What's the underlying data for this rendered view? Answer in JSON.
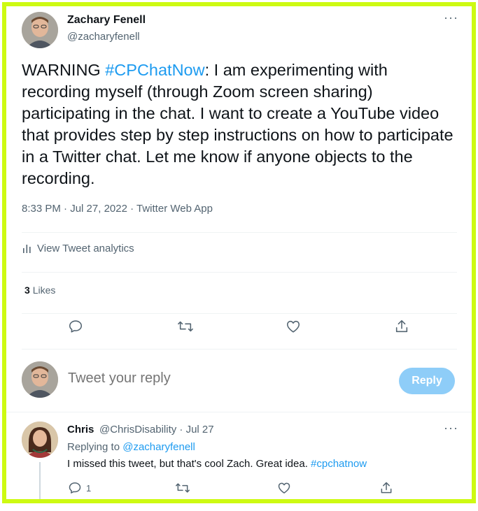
{
  "author": {
    "name": "Zachary Fenell",
    "handle": "@zacharyfenell"
  },
  "tweet": {
    "text_before": "WARNING ",
    "hashtag": "#CPChatNow",
    "text_after": ": I am experimenting with recording myself (through Zoom screen sharing) participating in the chat. I want to create a YouTube video that provides step by step instructions on how to participate in a Twitter chat. Let me know if anyone objects to the recording.",
    "time": "8:33 PM",
    "separator": " · ",
    "date": "Jul 27, 2022",
    "source": "Twitter Web App"
  },
  "more_label": "···",
  "analytics_label": "View Tweet analytics",
  "likes": {
    "count": "3",
    "label": "Likes"
  },
  "reply_box": {
    "placeholder": "Tweet your reply",
    "button_label": "Reply"
  },
  "reply": {
    "name": "Chris",
    "handle_and_date": "@ChrisDisability · Jul 27",
    "replying_prefix": "Replying to ",
    "replying_to": "@zacharyfenell",
    "text_before": "I missed this tweet, but that's cool Zach. Great idea. ",
    "hashtag": "#cpchatnow",
    "reply_count": "1"
  },
  "colors": {
    "frame": "#cdfa12",
    "link": "#1d9bf0",
    "muted": "#536471",
    "reply_button": "#8ecdf8"
  },
  "icons": [
    "more-icon",
    "analytics-icon",
    "reply-icon",
    "retweet-icon",
    "like-icon",
    "share-icon"
  ]
}
